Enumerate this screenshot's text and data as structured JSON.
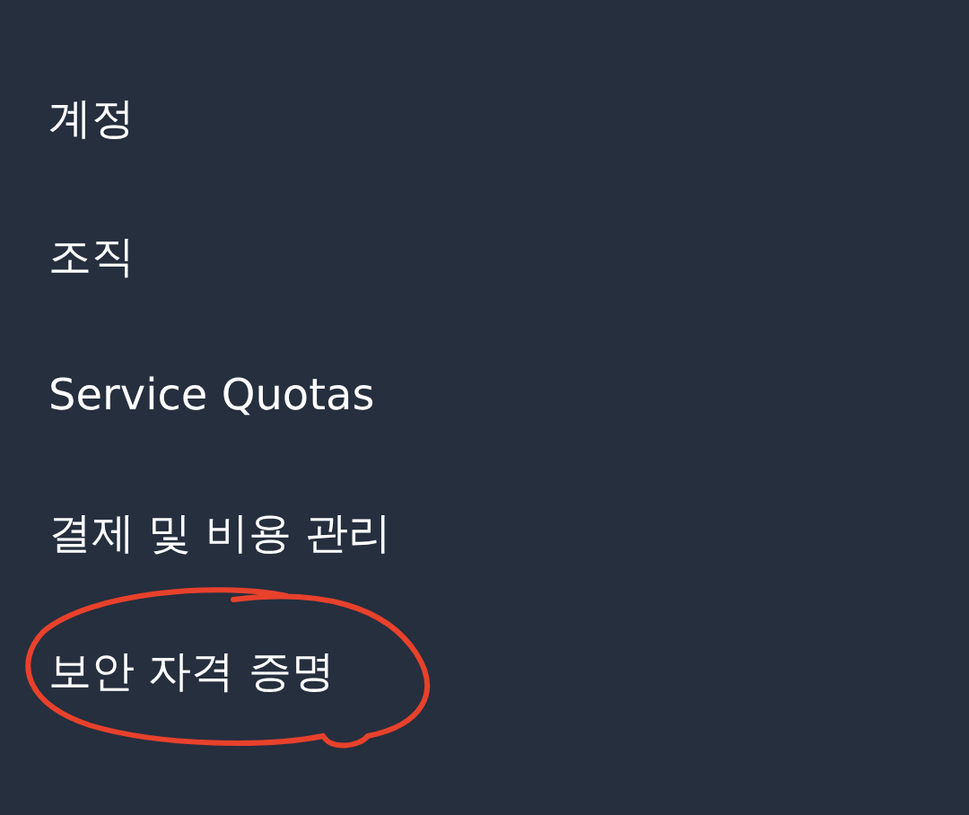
{
  "menu": {
    "items": [
      {
        "label": "계정",
        "circled": false
      },
      {
        "label": "조직",
        "circled": false
      },
      {
        "label": "Service Quotas",
        "circled": false
      },
      {
        "label": "결제 및 비용 관리",
        "circled": false
      },
      {
        "label": "보안 자격 증명",
        "circled": true
      }
    ]
  }
}
